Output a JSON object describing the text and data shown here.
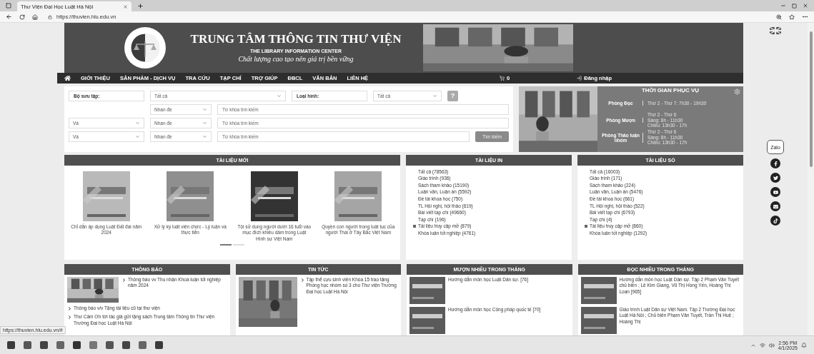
{
  "browser": {
    "tab_title": "Thư Viện Đại Học Luật Hà Nội",
    "url": "https://thuvien.hlu.edu.vn",
    "status_url": "https://thuvien.hlu.edu.vn/#"
  },
  "header": {
    "title": "TRUNG TÂM THÔNG TIN THƯ VIỆN",
    "subtitle": "THE LIBRARY INFORMATION CENTER",
    "slogan": "Chất lượng cao tạo nên giá trị bền vững"
  },
  "nav": {
    "items": [
      "GIỚI THIỆU",
      "SẢN PHẨM - DỊCH VỤ",
      "TRA CỨU",
      "TẠP CHÍ",
      "TRỢ GIÚP",
      "ĐBCL",
      "VĂN BẢN",
      "LIÊN HỆ"
    ],
    "cart_count": "0",
    "login": "Đăng nhập"
  },
  "search": {
    "collection_label": "Bộ sưu tập:",
    "collection_value": "Tất cả",
    "type_label": "Loại hình:",
    "type_value": "Tất cả",
    "help": "?",
    "button": "Tìm kiếm",
    "rows": [
      {
        "field": "Nhan đề",
        "placeholder": "Từ khóa tìm kiếm"
      },
      {
        "operator": "Và",
        "field": "Nhan đề",
        "placeholder": "Từ khóa tìm kiếm"
      },
      {
        "operator": "Và",
        "field": "Nhan đề",
        "placeholder": "Từ khóa tìm kiếm"
      }
    ]
  },
  "schedule": {
    "title": "THỜI GIAN PHỤC VỤ",
    "rooms": [
      {
        "name": "Phòng Đọc",
        "hours": [
          "Thứ 2 - Thứ 7: 7h30 - 19h30"
        ]
      },
      {
        "name": "Phòng Mượn",
        "hours": [
          "Thứ 2 - Thứ 6",
          "Sáng: 8h - 11h30",
          "Chiều: 13h30 - 17h"
        ]
      },
      {
        "name": "Phòng Thảo luận nhóm",
        "hours": [
          "Thứ 2 - Thứ 6",
          "Sáng: 8h - 11h30",
          "Chiều: 13h30 - 17h"
        ]
      }
    ]
  },
  "new_documents": {
    "title": "TÀI LIỆU MỚI",
    "books": [
      {
        "caption": "Chỉ dẫn áp dụng Luật Đất đai năm 2024"
      },
      {
        "caption": "Xử lý kỷ luật viên chức - Lý luận và thực tiễn"
      },
      {
        "caption": "Tội sử dụng người dưới 16 tuổi vào mục đích khiêu dâm trong Luật Hình sự Việt Nam"
      },
      {
        "caption": "Quyền con người trong luật tục của người Thái ở Tây Bắc Việt Nam"
      }
    ],
    "pages": [
      {
        "selected": true
      },
      {
        "selected": false
      }
    ]
  },
  "printed": {
    "title": "TÀI LIỆU IN",
    "items": [
      {
        "label": "Tất cả (78563)",
        "expandable": false
      },
      {
        "label": "Giáo trình (936)",
        "expandable": false
      },
      {
        "label": "Sách tham khảo (15190)",
        "expandable": false
      },
      {
        "label": "Luận văn, Luận án (5592)",
        "expandable": false
      },
      {
        "label": "Đề tài khoa học (750)",
        "expandable": false
      },
      {
        "label": "TL Hội nghị, hội thảo (619)",
        "expandable": false
      },
      {
        "label": "Bài viết tạp chí (49660)",
        "expandable": false
      },
      {
        "label": "Tạp chí (196)",
        "expandable": false
      },
      {
        "label": "Tài liệu truy cập mở (879)",
        "expandable": true
      },
      {
        "label": "Khóa luận tốt nghiệp (4761)",
        "expandable": false
      }
    ]
  },
  "digital": {
    "title": "TÀI LIỆU SỐ",
    "items": [
      {
        "label": "Tất cả (16003)",
        "expandable": false
      },
      {
        "label": "Giáo trình (171)",
        "expandable": false
      },
      {
        "label": "Sách tham khảo (224)",
        "expandable": false
      },
      {
        "label": "Luận văn, Luận án (5476)",
        "expandable": false
      },
      {
        "label": "Đề tài khoa học (661)",
        "expandable": false
      },
      {
        "label": "TL Hội nghị, hội thảo (522)",
        "expandable": false
      },
      {
        "label": "Bài viết tạp chí (6793)",
        "expandable": false
      },
      {
        "label": "Tạp chí (4)",
        "expandable": false
      },
      {
        "label": "Tài liệu truy cập mở (860)",
        "expandable": true
      },
      {
        "label": "Khóa luận tốt nghiệp (1292)",
        "expandable": false
      }
    ]
  },
  "announcements": {
    "title": "THÔNG BÁO",
    "featured": "Thông báo vv Thu nhận Khoá luận tốt nghiệp năm 2024",
    "items": [
      "Thông báo v/v Tặng tài liệu cũ tại thư viện",
      "Thư Cảm Ơn tới tác giả gửi tặng sách Trung tâm Thông tin Thư viện Trường Đại học Luật Hà Nội"
    ]
  },
  "news": {
    "title": "TIN TỨC",
    "featured": "Tập thể cựu sinh viên Khóa 15 trao tặng Phòng học nhóm số 3 cho Thư viện Trường Đại học Luật Hà Nội"
  },
  "most_borrowed": {
    "title": "MƯỢN NHIỀU TRONG THÁNG",
    "items": [
      "Hướng dẫn môn học Luật Dân sự. [76]",
      "Hướng dẫn môn học Công pháp quốc tế [70]"
    ]
  },
  "most_read": {
    "title": "ĐỌC NHIỀU TRONG THÁNG",
    "items": [
      "Hướng dẫn môn học Luật Dân sự. Tập 2 Phạm Văn Tuyết chủ biên ; Lê Kim Giang, Vũ Thị Hồng Yến, Hoàng Thị Loan [965]",
      "Giáo trình Luật Dân sự Việt Nam. Tập 2 Trường Đại học Luật Hà Nội ; Chủ biên Phạm Văn Tuyết, Trần Thị Huệ ; Hoàng Thị"
    ]
  },
  "social": {
    "zalo": "Zalo"
  },
  "taskbar": {
    "time": "2:56 PM",
    "date": "4/1/2025"
  }
}
